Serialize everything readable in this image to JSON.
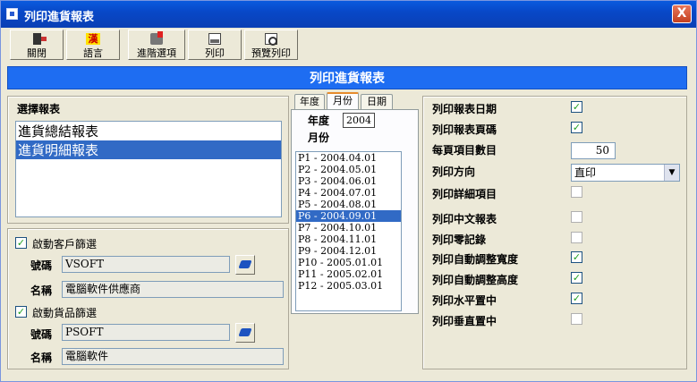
{
  "window": {
    "title": "列印進貨報表",
    "close_label": "X"
  },
  "toolbar": {
    "close_label": "關閉",
    "language_label": "語言",
    "language_glyph": "漢",
    "advanced_label": "進階選項",
    "print_label": "列印",
    "preview_label": "預覽列印"
  },
  "banner_title": "列印進貨報表",
  "report_select": {
    "title": "選擇報表",
    "items": [
      "進貨總結報表",
      "進貨明細報表"
    ],
    "selected_index": 1
  },
  "customer_filter": {
    "enable_label": "啟動客戶篩選",
    "enabled": true,
    "code_label": "號碼",
    "code_value": "VSOFT",
    "name_label": "名稱",
    "name_value": "電腦軟件供應商"
  },
  "product_filter": {
    "enable_label": "啟動貨品篩選",
    "enabled": true,
    "code_label": "號碼",
    "code_value": "PSOFT",
    "name_label": "名稱",
    "name_value": "電腦軟件"
  },
  "period": {
    "tabs": [
      "年度",
      "月份",
      "日期"
    ],
    "active_tab": 1,
    "year_label": "年度",
    "year_value": "2004",
    "month_label": "月份",
    "months": [
      "P1 - 2004.04.01",
      "P2 - 2004.05.01",
      "P3 - 2004.06.01",
      "P4 - 2004.07.01",
      "P5 - 2004.08.01",
      "P6 - 2004.09.01",
      "P7 - 2004.10.01",
      "P8 - 2004.11.01",
      "P9 - 2004.12.01",
      "P10 - 2005.01.01",
      "P11 - 2005.02.01",
      "P12 - 2005.03.01"
    ],
    "selected_month_index": 5
  },
  "options": {
    "print_date_label": "列印報表日期",
    "print_date": true,
    "print_page_label": "列印報表頁碼",
    "print_page": true,
    "items_per_page_label": "每頁項目數目",
    "items_per_page": "50",
    "orientation_label": "列印方向",
    "orientation_value": "直印",
    "print_details_label": "列印詳細項目",
    "print_details": false,
    "print_chinese_label": "列印中文報表",
    "print_chinese": false,
    "print_zero_label": "列印零記錄",
    "print_zero": false,
    "auto_width_label": "列印自動調整寬度",
    "auto_width": true,
    "auto_height_label": "列印自動調整高度",
    "auto_height": true,
    "center_h_label": "列印水平置中",
    "center_h": true,
    "center_v_label": "列印垂直置中",
    "center_v": false
  }
}
